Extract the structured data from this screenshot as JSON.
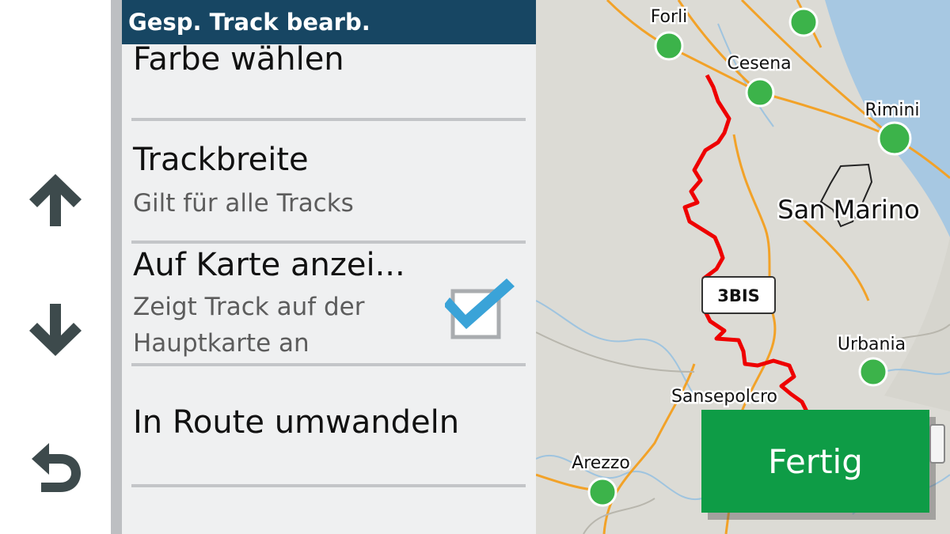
{
  "panel": {
    "title": "Gesp. Track bearb.",
    "items": [
      {
        "label": "Farbe wählen"
      },
      {
        "label": "Trackbreite",
        "sub": "Gilt für alle Tracks"
      },
      {
        "label": "Auf Karte anzei...",
        "sub1": "Zeigt Track auf der",
        "sub2": "Hauptkarte an",
        "checked": true
      },
      {
        "label": "In Route umwandeln"
      }
    ]
  },
  "nav": {
    "up_icon": "arrow-up-icon",
    "down_icon": "arrow-down-icon",
    "back_icon": "back-arrow-icon"
  },
  "map": {
    "cities": [
      "Forli",
      "Cesena",
      "Rimini",
      "San Marino",
      "Urbania",
      "Sansepolcro",
      "Arezzo"
    ],
    "road_shield": "3BIS",
    "colors": {
      "track": "#ee0000",
      "city": "#3cb34a",
      "road": "#f2a228",
      "sea": "#a7c8e2",
      "land": "#dcdbd5"
    }
  },
  "actions": {
    "done_label": "Fertig",
    "done_color": "#0e9c46"
  }
}
